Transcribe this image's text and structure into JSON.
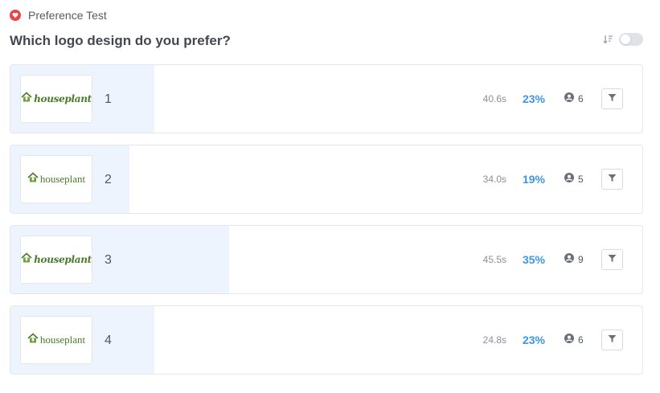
{
  "header": {
    "test_type": "Preference Test",
    "question": "Which logo design do you prefer?",
    "sort_toggle_on": false
  },
  "accent_color": "#3e95e6",
  "brand_color": "#e8454b",
  "options": [
    {
      "number": "1",
      "logo_text": "houseplant",
      "logo_style": "script",
      "time": "40.6s",
      "percent": "23%",
      "share": 0.23,
      "voters": "6"
    },
    {
      "number": "2",
      "logo_text": "houseplant",
      "logo_style": "plain",
      "time": "34.0s",
      "percent": "19%",
      "share": 0.19,
      "voters": "5"
    },
    {
      "number": "3",
      "logo_text": "houseplant",
      "logo_style": "script",
      "time": "45.5s",
      "percent": "35%",
      "share": 0.35,
      "voters": "9"
    },
    {
      "number": "4",
      "logo_text": "houseplant",
      "logo_style": "plain",
      "time": "24.8s",
      "percent": "23%",
      "share": 0.23,
      "voters": "6"
    }
  ],
  "icons": {
    "test_type": "heart-icon",
    "sort": "sort-icon",
    "voters": "user-icon",
    "filter": "filter-icon",
    "logo": "house-leaf-icon"
  }
}
